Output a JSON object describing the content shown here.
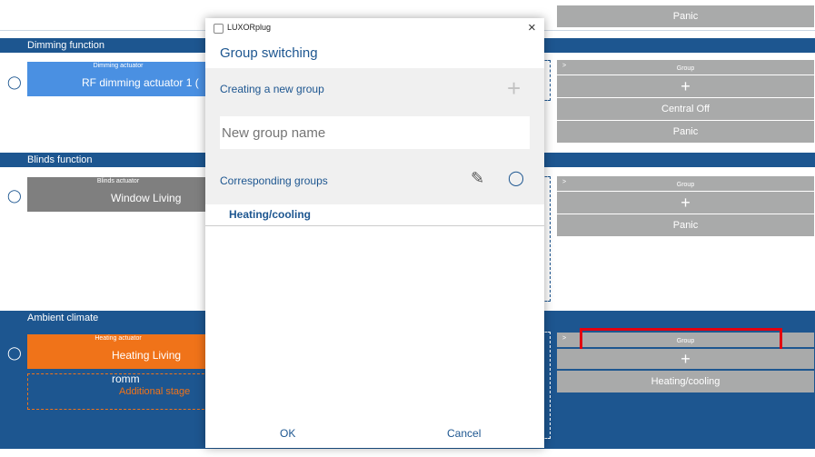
{
  "page": {
    "top_panic": "Panic"
  },
  "sections": {
    "dimming": {
      "title": "Dimming function",
      "actuator_label": "Dimming actuator",
      "actuator_name": "RF dimming actuator 1 (",
      "group_header": "Group",
      "group_arrow": ">",
      "add": "+",
      "items": [
        "Central Off",
        "Panic"
      ]
    },
    "blinds": {
      "title": "Blinds function",
      "actuator_label": "Blinds actuator",
      "actuator_name": "Window Living Room",
      "group_header": "Group",
      "group_arrow": ">",
      "add": "+",
      "items": [
        "Panic"
      ]
    },
    "ambient": {
      "title": "Ambient climate",
      "actuator_label": "Heating actuator",
      "actuator_name": "Heating Living romm",
      "additional_stage": "Additional stage",
      "group_header": "Group",
      "group_arrow": ">",
      "add": "+",
      "items": [
        "Heating/cooling"
      ]
    }
  },
  "dialog": {
    "app_title": "LUXORplug",
    "close": "×",
    "title": "Group switching",
    "creating_label": "Creating a new group",
    "add": "+",
    "name_placeholder": "New group name",
    "corresponding_label": "Corresponding groups",
    "groups": [
      "Heating/cooling"
    ],
    "ok": "OK",
    "cancel": "Cancel"
  },
  "colors": {
    "band": "#1d5690",
    "dimming": "#4a90e2",
    "blinds": "#7f7f7f",
    "heating": "#f07319",
    "grey_cell": "#a9aaaa",
    "highlight": "#e3000f"
  }
}
